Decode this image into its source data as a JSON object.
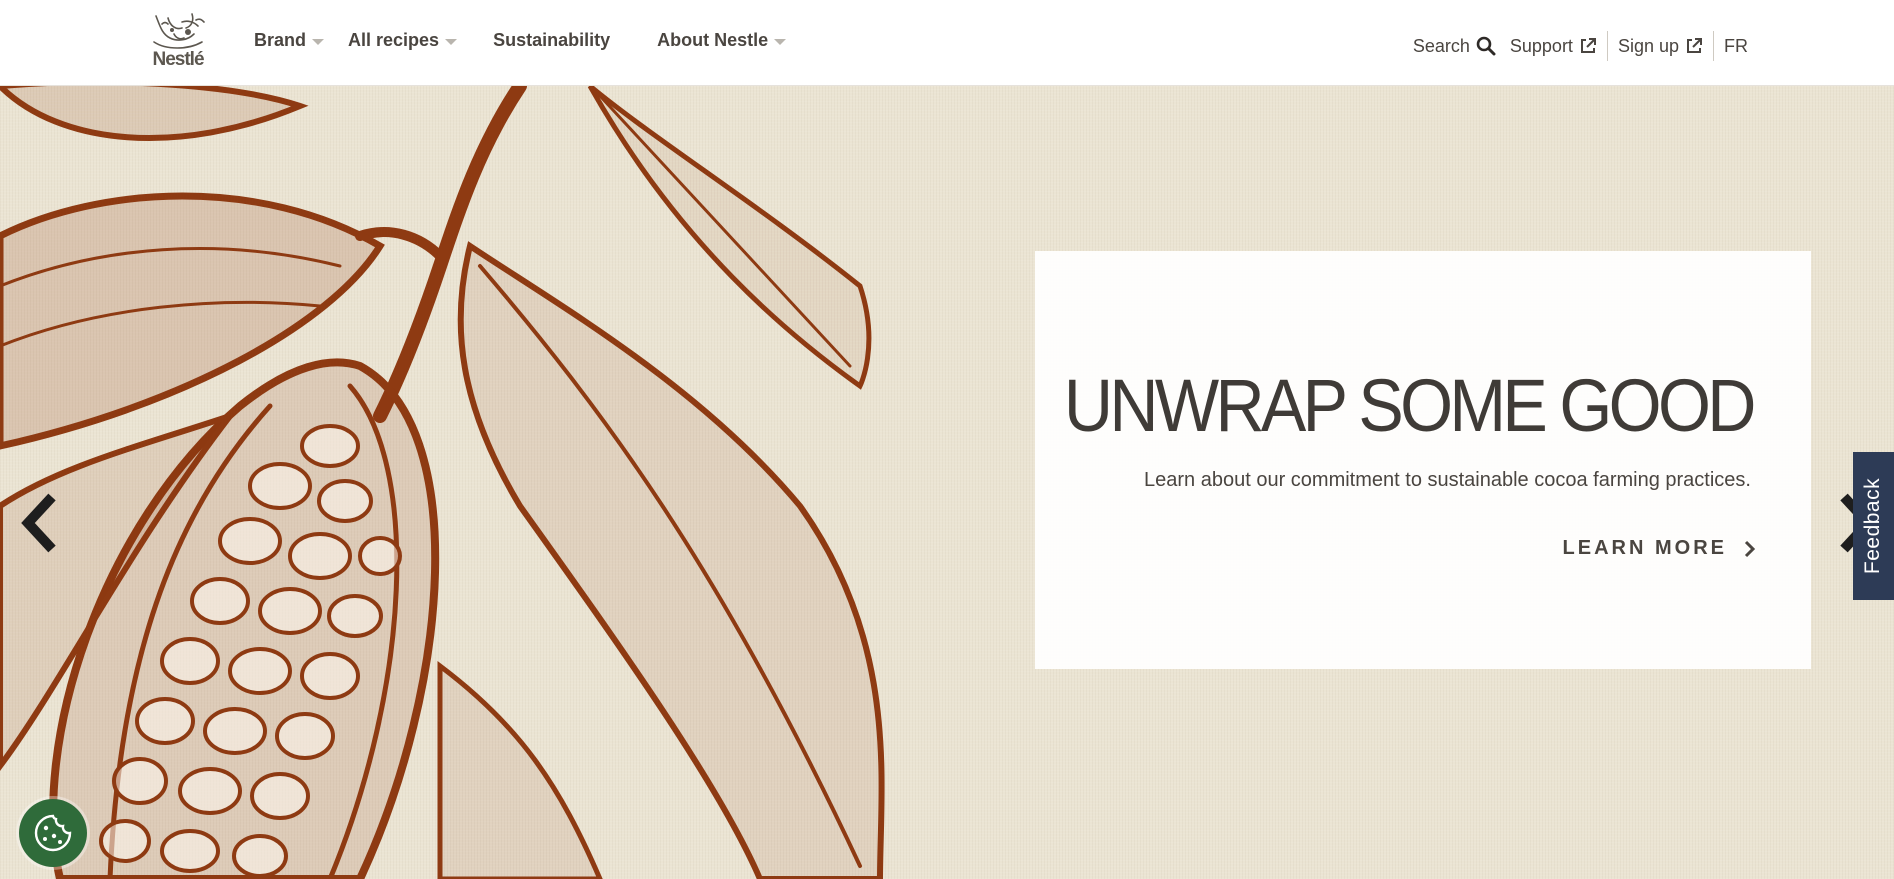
{
  "brand": {
    "logo_text": "Nestlé"
  },
  "nav": {
    "items": [
      {
        "label": "Brand",
        "has_dropdown": true
      },
      {
        "label": "All recipes",
        "has_dropdown": true
      },
      {
        "label": "Sustainability",
        "has_dropdown": false
      },
      {
        "label": "About Nestle",
        "has_dropdown": true
      }
    ]
  },
  "utility": {
    "search_label": "Search",
    "support_label": "Support",
    "signup_label": "Sign up",
    "language_label": "FR"
  },
  "hero": {
    "title": "UNWRAP SOME GOOD",
    "text": "Learn about our commitment to sustainable cocoa farming practices.",
    "cta_label": "LEARN MORE"
  },
  "feedback": {
    "label": "Feedback"
  },
  "colors": {
    "illustration": "#8e3a12",
    "background": "#ebe4d3",
    "feedback_bg": "#2d3b56",
    "cookie_bg": "#2f6b3a",
    "text": "#4a4540"
  },
  "icons": [
    "search-icon",
    "external-link-icon",
    "chevron-left-icon",
    "chevron-right-icon",
    "cookie-icon",
    "nestle-logo-icon"
  ]
}
